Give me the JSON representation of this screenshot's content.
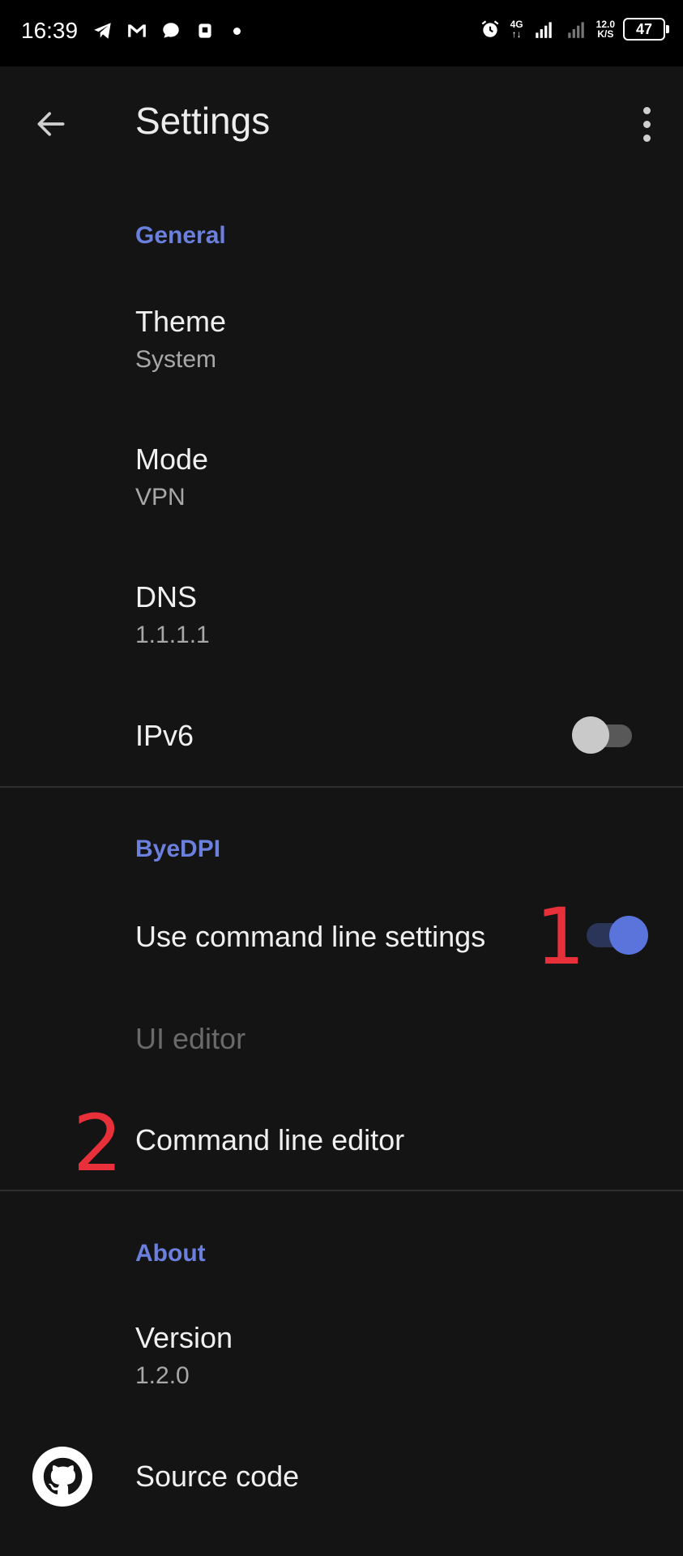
{
  "status_bar": {
    "time": "16:39",
    "network_label": "4G",
    "speed_value": "12.0",
    "speed_unit": "K/S",
    "battery": "47"
  },
  "app_bar": {
    "title": "Settings",
    "back_icon": "arrow-left-icon",
    "menu_icon": "more-vert-icon"
  },
  "sections": {
    "general": {
      "label": "General",
      "theme": {
        "title": "Theme",
        "value": "System"
      },
      "mode": {
        "title": "Mode",
        "value": "VPN"
      },
      "dns": {
        "title": "DNS",
        "value": "1.1.1.1"
      },
      "ipv6": {
        "title": "IPv6",
        "enabled": false
      }
    },
    "byedpi": {
      "label": "ByeDPI",
      "use_cmd": {
        "title": "Use command line settings",
        "enabled": true
      },
      "ui_editor": {
        "title": "UI editor"
      },
      "cmd_editor": {
        "title": "Command line editor"
      }
    },
    "about": {
      "label": "About",
      "version": {
        "title": "Version",
        "value": "1.2.0"
      },
      "source": {
        "title": "Source code",
        "icon": "github-icon"
      }
    }
  },
  "annotations": {
    "one": "1",
    "two": "2"
  },
  "colors": {
    "accent": "#6b7fdc",
    "annotation": "#e8303a",
    "background": "#141414"
  }
}
